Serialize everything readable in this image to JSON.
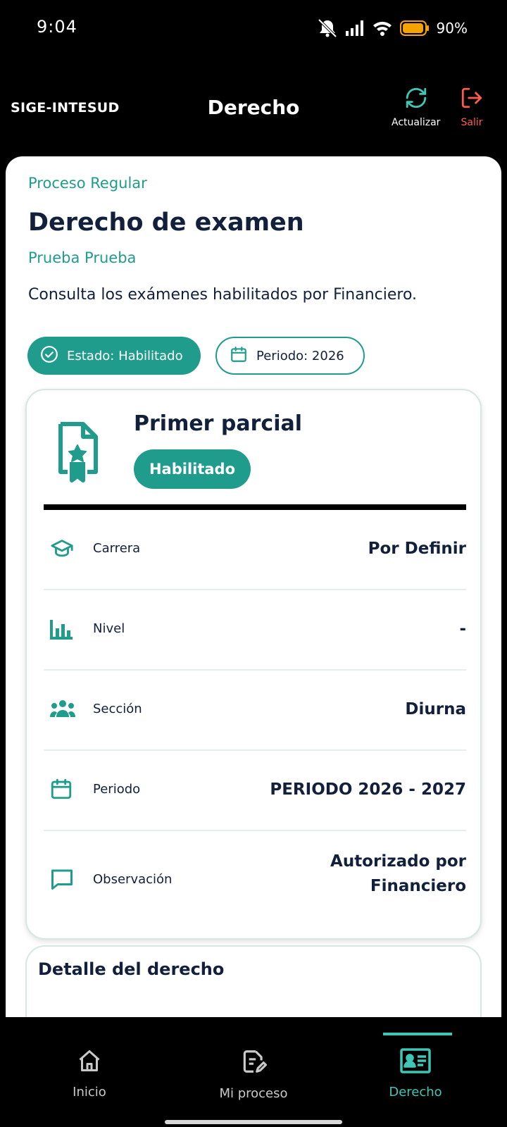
{
  "status_bar": {
    "time": "9:04",
    "battery": "90%"
  },
  "header": {
    "brand": "SIGE-INTESUD",
    "title": "Derecho",
    "refresh_label": "Actualizar",
    "logout_label": "Salir"
  },
  "page": {
    "eyebrow": "Proceso Regular",
    "title": "Derecho de examen",
    "student": "Prueba Prueba",
    "description": "Consulta los exámenes habilitados por Financiero."
  },
  "chips": {
    "status": "Estado: Habilitado",
    "period": "Periodo: 2026"
  },
  "exam": {
    "title": "Primer parcial",
    "badge": "Habilitado",
    "rows": [
      {
        "icon": "graduation-cap-icon",
        "label": "Carrera",
        "value": "Por Definir"
      },
      {
        "icon": "bar-chart-icon",
        "label": "Nivel",
        "value": "-"
      },
      {
        "icon": "people-group-icon",
        "label": "Sección",
        "value": "Diurna"
      },
      {
        "icon": "calendar-icon",
        "label": "Periodo",
        "value": "PERIODO 2026 - 2027"
      },
      {
        "icon": "comment-icon",
        "label": "Observación",
        "value_line1": "Autorizado por",
        "value_line2": "Financiero"
      }
    ]
  },
  "detail": {
    "title": "Detalle del derecho"
  },
  "nav": {
    "items": [
      {
        "label": "Inicio",
        "icon": "home-icon"
      },
      {
        "label": "Mi proceso",
        "icon": "document-edit-icon"
      },
      {
        "label": "Derecho",
        "icon": "id-card-icon",
        "active": true
      }
    ]
  },
  "colors": {
    "accent": "#1f9c8c",
    "nav_active": "#3fc6b4",
    "logout": "#ff5a4e",
    "text": "#12203b"
  }
}
